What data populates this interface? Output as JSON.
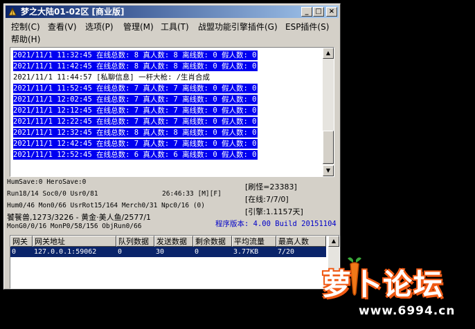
{
  "window": {
    "title": "梦之大陆01-02区 [商业版]",
    "minimize_glyph": "_",
    "maximize_glyph": "□",
    "close_glyph": "×"
  },
  "menu": [
    {
      "label": "控制(C)"
    },
    {
      "label": "查看(V)"
    },
    {
      "label": "选项(P)"
    },
    {
      "label": "管理(M)"
    },
    {
      "label": "工具(T)"
    },
    {
      "label": "战盟功能引擎插件(G)"
    },
    {
      "label": "ESP插件(S)"
    },
    {
      "label": "帮助(H)"
    }
  ],
  "log": [
    {
      "text": "2021/11/1 11:32:45 在线总数: 8 真人数: 8 离线数: 0 假人数: 0",
      "selected": true
    },
    {
      "text": "2021/11/1 11:42:45 在线总数: 8 真人数: 8 离线数: 0 假人数: 0",
      "selected": true
    },
    {
      "text": "2021/11/1 11:44:57 [私聊信息] 一杆大枪: /生肖合成",
      "selected": false
    },
    {
      "text": "2021/11/1 11:52:45 在线总数: 7 真人数: 7 离线数: 0 假人数: 0",
      "selected": true
    },
    {
      "text": "2021/11/1 12:02:45 在线总数: 7 真人数: 7 离线数: 0 假人数: 0",
      "selected": true
    },
    {
      "text": "2021/11/1 12:12:45 在线总数: 7 真人数: 7 离线数: 0 假人数: 0",
      "selected": true
    },
    {
      "text": "2021/11/1 12:22:45 在线总数: 7 真人数: 7 离线数: 0 假人数: 0",
      "selected": true
    },
    {
      "text": "2021/11/1 12:32:45 在线总数: 8 真人数: 8 离线数: 0 假人数: 0",
      "selected": true
    },
    {
      "text": "2021/11/1 12:42:45 在线总数: 7 真人数: 7 离线数: 0 假人数: 0",
      "selected": true
    },
    {
      "text": "2021/11/1 12:52:45 在线总数: 6 真人数: 6 离线数: 0 假人数: 0",
      "selected": true
    }
  ],
  "stats": {
    "line1": "HumSave:0 HeroSave:0",
    "line2a": "Run18/14 Soc0/0 Usr0/81",
    "line2b": "26:46:33 [M][F]",
    "line3": "Hum0/46 Mon0/66 UsrRot15/164 Merch0/31 Npc0/16 (0)",
    "line4": "饕餮兽,1273/3226 - 黄金·美人鱼/2577/1",
    "line5": "MonG0/0/16 MonP0/58/156 ObjRun0/66"
  },
  "right_stats": {
    "refresh": "[刷怪=23383]",
    "online": "[在线:7/7/0]",
    "engine": "[引擎:1.1157天]",
    "version": "程序版本: 4.00 Build 20151104"
  },
  "grid": {
    "columns": [
      "网关",
      "网关地址",
      "队列数据",
      "发送数据",
      "剩余数据",
      "平均流量",
      "最高人数"
    ],
    "rows": [
      [
        "0",
        "127.0.0.1:59062",
        "0",
        "30",
        "0",
        "3.77KB",
        "7/20"
      ]
    ]
  },
  "watermark": {
    "logo_text": "萝卜论坛",
    "url": "www.6994.cn"
  },
  "colors": {
    "selection": "#0000f0",
    "window_bg": "#d4d0c8",
    "version_text": "#0000c8",
    "watermark_orange": "#f05a14"
  }
}
